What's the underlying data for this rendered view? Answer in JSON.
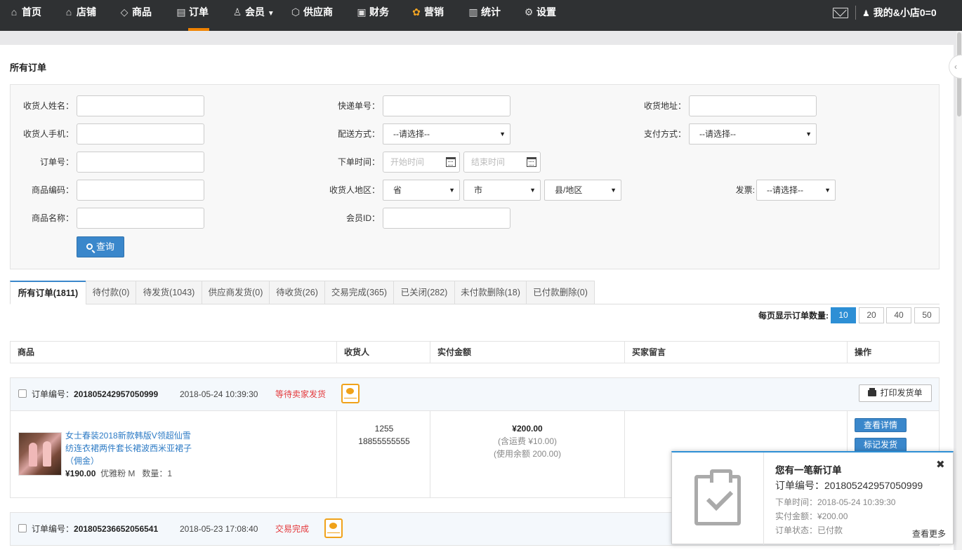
{
  "nav": {
    "items": [
      {
        "label": "首页",
        "icon": "home-icon",
        "glyph": "⌂"
      },
      {
        "label": "店铺",
        "icon": "store-icon",
        "glyph": "⌂"
      },
      {
        "label": "商品",
        "icon": "tag-icon",
        "glyph": "◇"
      },
      {
        "label": "订单",
        "icon": "document-icon",
        "glyph": "▤"
      },
      {
        "label": "会员",
        "icon": "user-icon",
        "glyph": "♙"
      },
      {
        "label": "供应商",
        "icon": "cube-icon",
        "glyph": "⬡"
      },
      {
        "label": "财务",
        "icon": "monitor-icon",
        "glyph": "▣"
      },
      {
        "label": "营销",
        "icon": "colorful-flower-icon",
        "glyph": "✿"
      },
      {
        "label": "统计",
        "icon": "bar-chart-icon",
        "glyph": "▥"
      },
      {
        "label": "设置",
        "icon": "gear-icon",
        "glyph": "⚙"
      }
    ],
    "member_dropdown": "▼",
    "user_label": "我的&小店0=0",
    "user_glyph": "♟"
  },
  "page_title": "所有订单",
  "filters": {
    "consignee_name": "收货人姓名：",
    "express_no": "快递单号：",
    "address": "收货地址：",
    "consignee_phone": "收货人手机：",
    "delivery_method": "配送方式：",
    "delivery_select": "--请选择--",
    "payment_method": "支付方式：",
    "payment_select": "--请选择--",
    "order_no": "订单号：",
    "order_time": "下单时间：",
    "start_time_placeholder": "开始时间",
    "end_time_placeholder": "结束时间",
    "product_code": "商品编码：",
    "region": "收货人地区：",
    "province": "省",
    "city": "市",
    "county": "县/地区",
    "invoice": "发票:",
    "invoice_select": "--请选择--",
    "product_name": "商品名称：",
    "member_id": "会员ID：",
    "query_button": "查询"
  },
  "tabs": [
    "所有订单(1811)",
    "待付款(0)",
    "待发货(1043)",
    "供应商发货(0)",
    "待收货(26)",
    "交易完成(365)",
    "已关闭(282)",
    "未付款删除(18)",
    "已付款删除(0)"
  ],
  "per_page": {
    "label": "每页显示订单数量:",
    "options": [
      "10",
      "20",
      "40",
      "50"
    ],
    "selected": "10"
  },
  "table_headers": [
    "商品",
    "收货人",
    "实付金额",
    "买家留言",
    "操作"
  ],
  "orders": [
    {
      "no_label": "订单编号：",
      "no": "201805242957050999",
      "time": "2018-05-24 10:39:30",
      "status": "等待卖家发货",
      "mini_program": "小程序",
      "print_button": "打印发货单",
      "product_title": "女士春装2018新款韩版V领超仙雪纺连衣裙两件套长裙波西米亚裙子（佣金）",
      "price": "¥190.00",
      "spec": "优雅粉 M",
      "qty": "数量：1",
      "receiver_name": "1255",
      "receiver_phone": "18855555555",
      "amount": "¥200.00",
      "freight": "(含运费 ¥10.00)",
      "balance": "(使用余额 200.00)",
      "detail_button": "查看详情",
      "ship_button": "标记发货"
    },
    {
      "no_label": "订单编号：",
      "no": "201805236652056541",
      "time": "2018-05-23 17:08:40",
      "status": "交易完成",
      "mini_program": "小程序"
    }
  ],
  "notification": {
    "title": "您有一笔新订单",
    "order_no": "订单编号：201805242957050999",
    "order_time": "下单时间：2018-05-24 10:39:30",
    "paid": "实付金额：¥200.00",
    "status": "订单状态：已付款",
    "more": "查看更多",
    "close": "✖"
  }
}
